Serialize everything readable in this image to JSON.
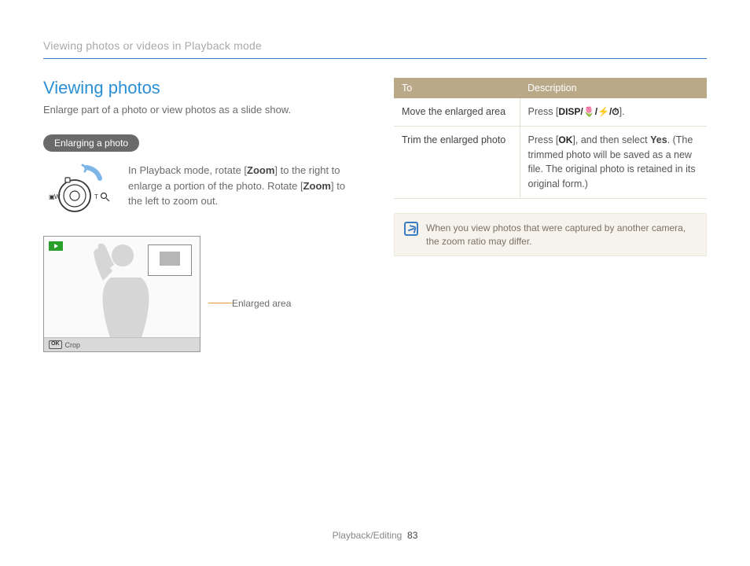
{
  "breadcrumb": "Viewing photos or videos in Playback mode",
  "section": {
    "heading": "Viewing photos",
    "sub": "Enlarge part of a photo or view photos as a slide show.",
    "pill": "Enlarging a photo",
    "zoom_text_1": "In Playback mode, rotate [",
    "zoom_key": "Zoom",
    "zoom_text_2": "] to the right to enlarge a portion of the photo. Rotate [",
    "zoom_text_3": "] to the left to zoom out.",
    "callout": "Enlarged area",
    "crop_label": "Crop"
  },
  "table": {
    "headers": {
      "col1": "To",
      "col2": "Description"
    },
    "rows": [
      {
        "to": "Move the enlarged area",
        "desc_pre": "Press [",
        "keys": "DISP/🌷/⚡/⏱",
        "desc_post": "]."
      },
      {
        "to": "Trim the enlarged photo",
        "desc_pre": "Press [",
        "keys": "OK",
        "desc_mid": "], and then select ",
        "yes": "Yes",
        "desc_post": ". (The trimmed photo will be saved as a new file. The original photo is retained in its original form.)"
      }
    ]
  },
  "note": "When you view photos that were captured by another camera, the zoom ratio may differ.",
  "footer": {
    "section": "Playback/Editing",
    "page": "83"
  },
  "zoom_dial": {
    "left": "W",
    "right": "T"
  }
}
